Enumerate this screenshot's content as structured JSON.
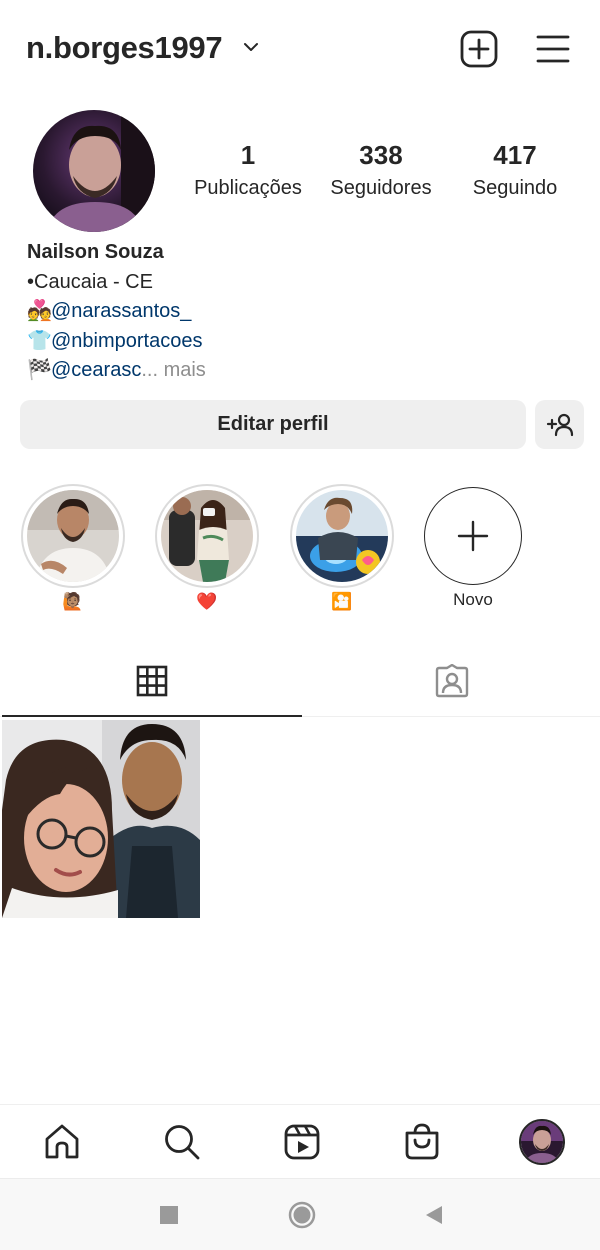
{
  "header": {
    "username": "n.borges1997",
    "chevron_icon": "chevron-down-icon",
    "new_post_icon": "plus-square-icon",
    "menu_icon": "hamburger-menu-icon"
  },
  "stats": [
    {
      "value": "1",
      "label": "Publicações"
    },
    {
      "value": "338",
      "label": "Seguidores"
    },
    {
      "value": "417",
      "label": "Seguindo"
    }
  ],
  "bio": {
    "name": "Nailson Souza",
    "location": "•Caucaia - CE",
    "links": [
      {
        "emoji": "💑",
        "handle": "@narassantos_"
      },
      {
        "emoji": "👕",
        "handle": "@nbimportacoes"
      },
      {
        "emoji": "🏁",
        "handle": "@cearasc",
        "truncation": "...",
        "more": "mais"
      }
    ]
  },
  "actions": {
    "edit_profile_label": "Editar perfil",
    "add_person_icon": "add-person-icon"
  },
  "highlights": [
    {
      "label": "🙋🏽",
      "icon": "person-photo"
    },
    {
      "label": "❤️",
      "icon": "couple-photo"
    },
    {
      "label": "🎦",
      "icon": "movie-photo"
    },
    {
      "label": "Novo",
      "icon": "plus-icon"
    }
  ],
  "tabs": [
    {
      "name": "posts-grid",
      "icon": "grid-icon",
      "active": true
    },
    {
      "name": "tagged",
      "icon": "tagged-person-icon",
      "active": false
    }
  ],
  "posts": [
    {
      "icon": "couple-selfie-photo"
    }
  ],
  "bottom_nav": [
    {
      "icon": "home-icon"
    },
    {
      "icon": "search-icon"
    },
    {
      "icon": "reels-icon"
    },
    {
      "icon": "shop-bag-icon"
    },
    {
      "icon": "profile-avatar"
    }
  ],
  "system_nav": [
    {
      "icon": "recents-square-icon"
    },
    {
      "icon": "home-circle-icon"
    },
    {
      "icon": "back-triangle-icon"
    }
  ],
  "colors": {
    "text": "#262626",
    "link": "#00376b",
    "muted": "#8e8e8e",
    "button_bg": "#efefef"
  }
}
